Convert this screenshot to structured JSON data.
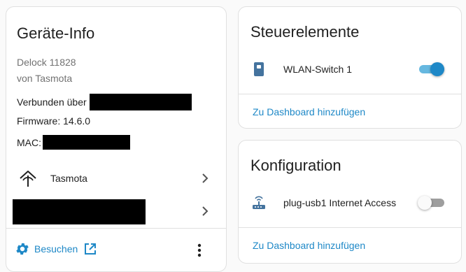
{
  "device_info": {
    "title": "Geräte-Info",
    "model": "Delock 11828",
    "manufacturer": "von Tasmota",
    "connected_via_label": "Verbunden über",
    "firmware": "Firmware: 14.6.0",
    "mac_label": "MAC:",
    "integration_label": "Tasmota",
    "search_label": "Besuchen"
  },
  "controls": {
    "title": "Steuerelemente",
    "entities": [
      {
        "label": "WLAN-Switch 1",
        "state": "on"
      }
    ],
    "add_to_dashboard": "Zu Dashboard hinzufügen"
  },
  "config": {
    "title": "Konfiguration",
    "entities": [
      {
        "label": "plug-usb1 Internet Access",
        "state": "off"
      }
    ],
    "add_to_dashboard": "Zu Dashboard hinzufügen"
  },
  "colors": {
    "accent": "#1e88c7",
    "card_bg": "#ffffff",
    "page_bg": "#fafafa",
    "muted_text": "#727272"
  }
}
